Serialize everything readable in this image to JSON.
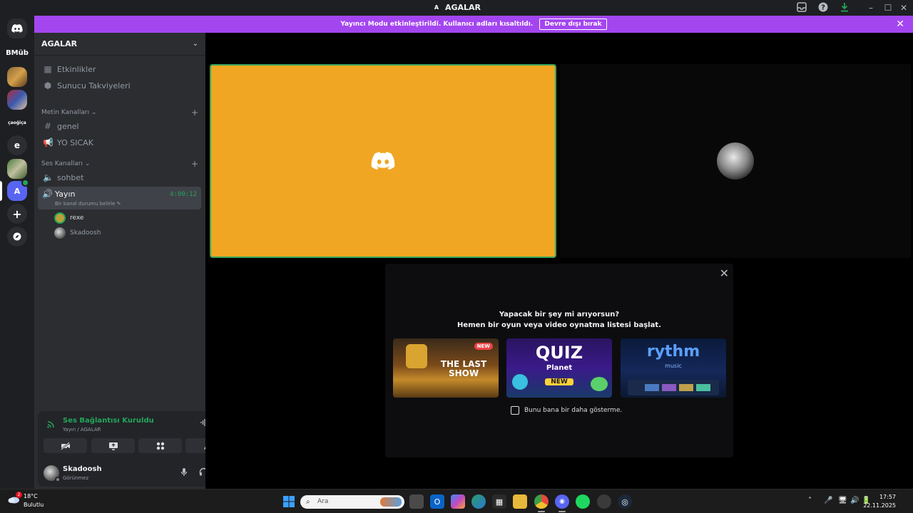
{
  "window": {
    "title": "AGALAR",
    "avatar_letter": "A"
  },
  "notice": {
    "text": "Yayıncı Modu etkinleştirildi. Kullanıcı adları kısaltıldı.",
    "button": "Devre dışı bırak"
  },
  "rail": {
    "folder_label": "BMüb",
    "text_server_1": "çaoğiça",
    "text_server_2": "e",
    "active_server_letter": "A"
  },
  "sidebar": {
    "server_name": "AGALAR",
    "events": "Etkinlikler",
    "boosts": "Sunucu Takviyeleri",
    "text_category": "Metin Kanalları",
    "text_channels": [
      "genel",
      "YO SICAK"
    ],
    "voice_category": "Ses Kanalları",
    "voice_channel_1": "sohbet",
    "active_voice": {
      "name": "Yayın",
      "timer": "4:00:12",
      "status": "Bir kanal durumu belirle"
    },
    "voice_users": [
      "rexe",
      "Skadoosh"
    ]
  },
  "voice_panel": {
    "title": "Ses Bağlantısı Kuruldu",
    "subtitle": "Yayın / AGALAR"
  },
  "user_panel": {
    "name": "Skadoosh",
    "status": "Görünmez"
  },
  "activity": {
    "heading_1": "Yapacak bir şey mi arıyorsun?",
    "heading_2": "Hemen bir oyun veya video oynatma listesi başlat.",
    "cards": [
      {
        "label": "THE LAST SHOW",
        "badge": "NEW"
      },
      {
        "label": "QUIZ",
        "sublabel": "Planet",
        "badge": "NEW"
      },
      {
        "label": "rythm",
        "sublabel": "music"
      }
    ],
    "checkbox_label": "Bunu bana bir daha gösterme."
  },
  "taskbar": {
    "weather_temp": "18°C",
    "weather_cond": "Bulutlu",
    "weather_badge": "2",
    "search_placeholder": "Ara",
    "time": "17:57",
    "date": "22.11.2025"
  },
  "colors": {
    "accent": "#a346f0",
    "voice_green": "#23a55a",
    "stream_tile": "#f0a623",
    "blurple": "#5865f2"
  }
}
